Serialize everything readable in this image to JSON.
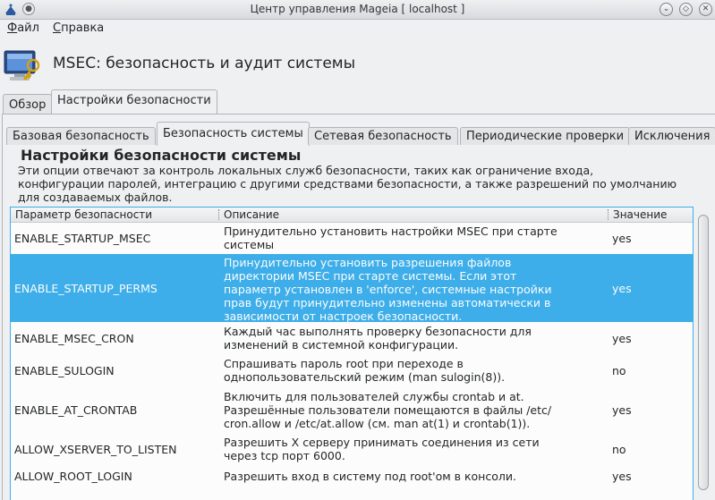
{
  "window": {
    "title": "Центр управления Mageia  [ localhost ]",
    "app_icon": "mageia-logo-icon",
    "buttons": [
      "minimize-icon",
      "maximize-icon",
      "close-icon"
    ]
  },
  "menu": {
    "file": "Файл",
    "help": "Справка"
  },
  "header": {
    "title": "MSEC: безопасность и аудит системы",
    "icon": "security-monitor-icon"
  },
  "main_tabs": [
    "Обзор",
    "Настройки безопасности"
  ],
  "sub_tabs": [
    "Базовая безопасность",
    "Безопасность системы",
    "Сетевая безопасность",
    "Периодические проверки",
    "Исключения"
  ],
  "section": {
    "title": "Настройки безопасности системы",
    "description_lines": [
      "Эти опции отвечают за контроль локальных служб безопасности, таких как ограничение входа,",
      "конфигурации паролей, интеграцию с другими средствами безопасности, а также разрешений  по умолчанию",
      "для создаваемых файлов."
    ]
  },
  "table": {
    "columns": [
      "Параметр безопасности",
      "Описание",
      "Значение"
    ],
    "rows": [
      {
        "param": "ENABLE_STARTUP_MSEC",
        "desc": [
          "Принудительно установить настройки MSEC при старте",
          "системы"
        ],
        "value": "yes",
        "selected": false
      },
      {
        "param": "ENABLE_STARTUP_PERMS",
        "desc": [
          "Принудительно установить разрешения файлов",
          "директории MSEC при старте системы. Если этот",
          "параметр установлен в 'enforce', системные настройки",
          "прав будут принудительно изменены автоматически в",
          "зависимости от настроек безопасности."
        ],
        "value": "yes",
        "selected": true
      },
      {
        "param": "ENABLE_MSEC_CRON",
        "desc": [
          "Каждый час выполнять проверку безопасности для",
          "изменений в системной конфигурации."
        ],
        "value": "yes",
        "selected": false
      },
      {
        "param": "ENABLE_SULOGIN",
        "desc": [
          "Спрашивать пароль root при переходе в",
          "однопользовательский режим (man sulogin(8))."
        ],
        "value": "no",
        "selected": false
      },
      {
        "param": "ENABLE_AT_CRONTAB",
        "desc": [
          "Включить для пользователей службы crontab и at.",
          "Разрешённые пользователи помещаются в файлы /etc/",
          "cron.allow и /etc/at.allow (см. man at(1) и crontab(1))."
        ],
        "value": "yes",
        "selected": false
      },
      {
        "param": "ALLOW_XSERVER_TO_LISTEN",
        "desc": [
          "Разрешить X серверу принимать соединения из сети",
          "через tcp порт 6000."
        ],
        "value": "no",
        "selected": false
      },
      {
        "param": "ALLOW_ROOT_LOGIN",
        "desc": [
          "Разрешить вход в систему под root'ом в консоли."
        ],
        "value": "yes",
        "selected": false
      }
    ]
  },
  "colors": {
    "accent": "#3daee9",
    "background": "#eff0f1",
    "text": "#232627"
  }
}
